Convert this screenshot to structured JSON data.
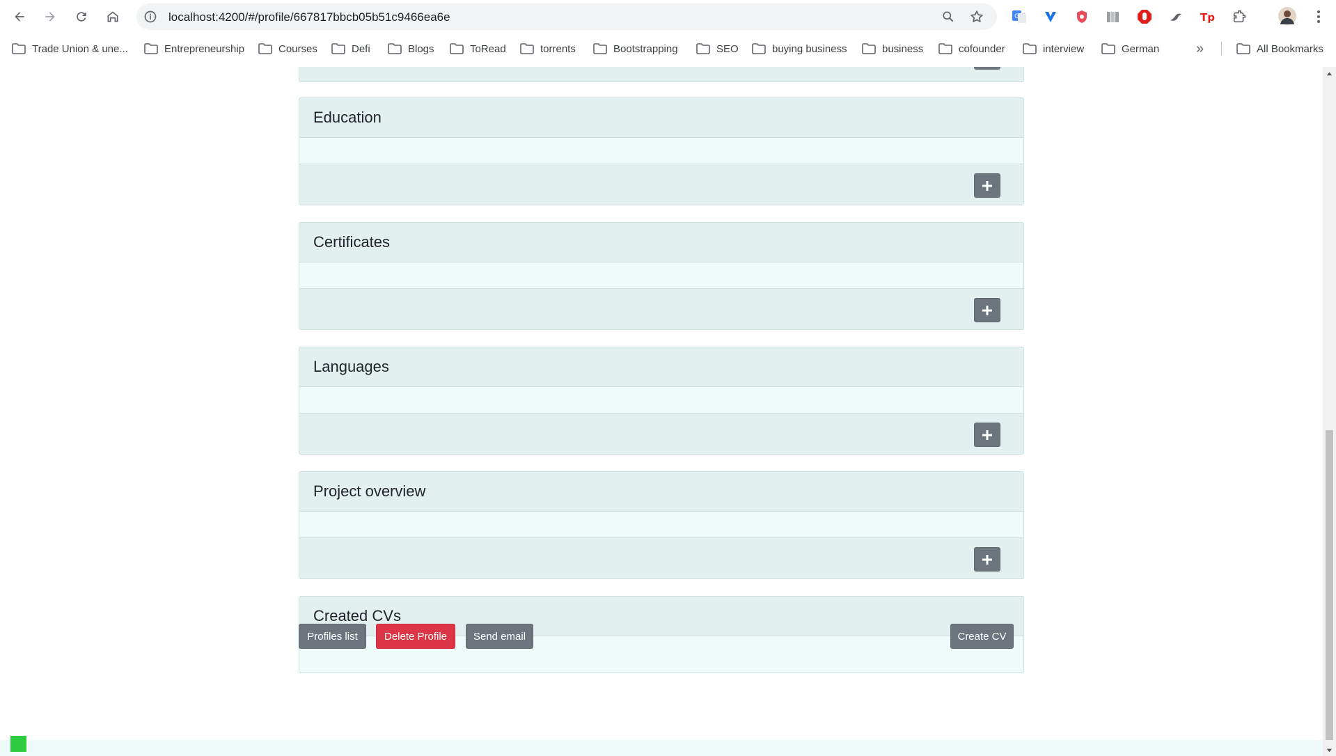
{
  "browser": {
    "url": "localhost:4200/#/profile/667817bbcb05b51c9466ea6e",
    "bookmarks": [
      "Trade Union & une...",
      "Entrepreneurship",
      "Courses",
      "Defi",
      "Blogs",
      "ToRead",
      "torrents",
      "Bootstrapping",
      "SEO",
      "buying business",
      "business",
      "cofounder",
      "interview",
      "German"
    ],
    "all_bookmarks_label": "All Bookmarks",
    "overflow_label": "»"
  },
  "sections": {
    "education": "Education",
    "certificates": "Certificates",
    "languages": "Languages",
    "project_overview": "Project overview",
    "created_cvs": "Created CVs"
  },
  "actions": {
    "profiles_list": "Profiles list",
    "delete_profile": "Delete Profile",
    "send_email": "Send email",
    "create_cv": "Create CV"
  },
  "colors": {
    "card_header": "#e2f0ef",
    "card_body": "#effafa",
    "secondary": "#6c757d",
    "danger": "#dc3545",
    "status": "#2ecc40"
  }
}
